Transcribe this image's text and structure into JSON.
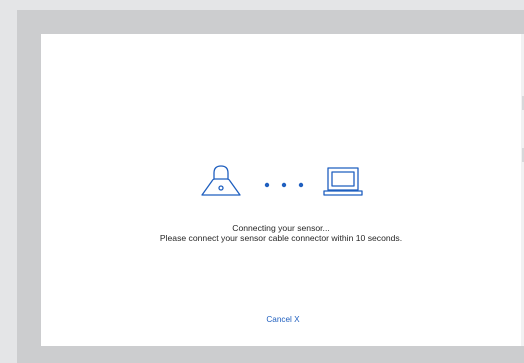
{
  "status": {
    "title": "Connecting your sensor...",
    "message": "Please connect your sensor cable connector within 10 seconds."
  },
  "actions": {
    "cancel_label": "Cancel X"
  },
  "illustration": {
    "icons": [
      "sensor-icon",
      "progress-dots-icon",
      "laptop-icon"
    ],
    "accent_color": "#1f5fbf"
  }
}
